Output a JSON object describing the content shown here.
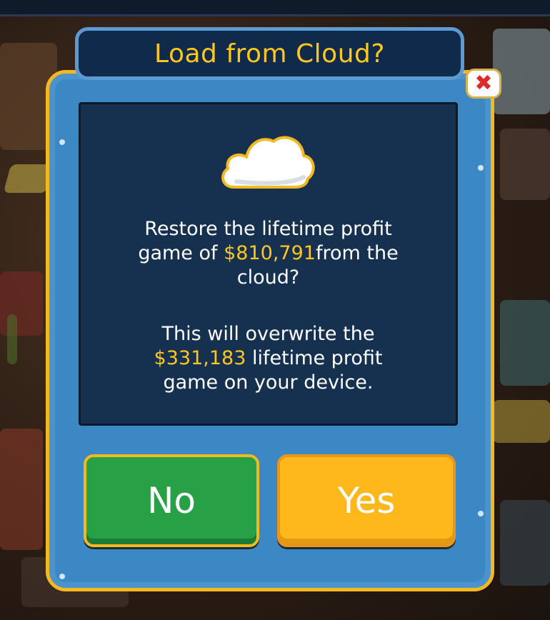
{
  "dialog": {
    "title": "Load from Cloud?",
    "close_glyph": "✖",
    "icon": "cloud-icon",
    "message1": {
      "line1": "Restore the lifetime profit",
      "line2_pre": "game of ",
      "cloud_amount": "$810,791",
      "line2_post": "from the",
      "line3": "cloud?"
    },
    "message2": {
      "line1": "This will overwrite the",
      "device_amount": "$331,183",
      "line2_post": " lifetime profit",
      "line3": "game on your device."
    },
    "buttons": {
      "no_label": "No",
      "yes_label": "Yes"
    }
  },
  "colors": {
    "accent_gold": "#ffc61e",
    "panel_blue": "#3b88c5",
    "content_navy": "#16304f",
    "no_green": "#27a046",
    "yes_yellow": "#ffb81c",
    "close_red": "#e02a2a"
  }
}
